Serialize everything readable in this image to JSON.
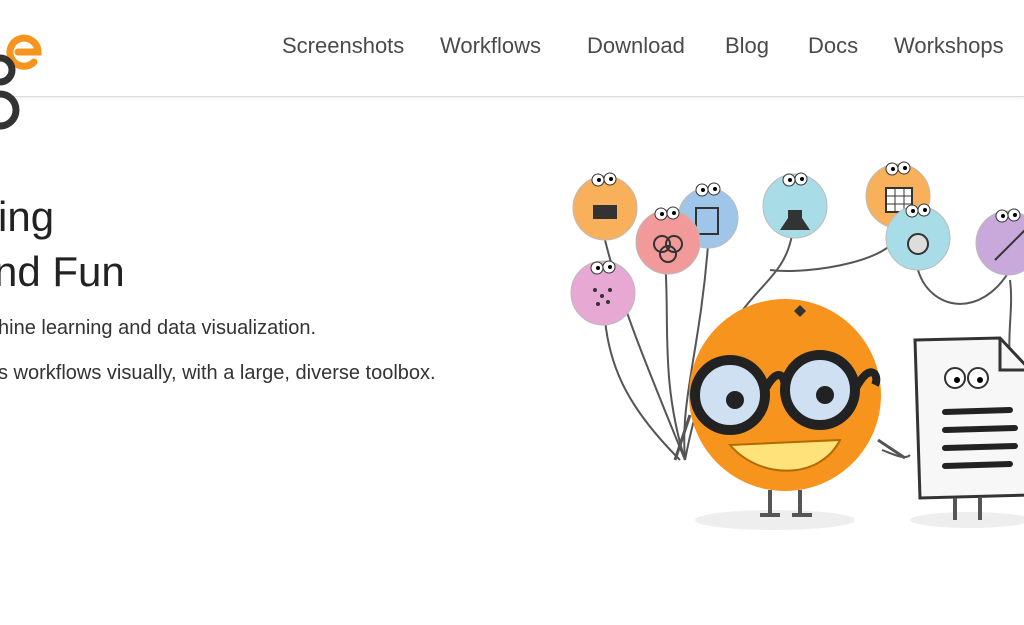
{
  "nav": {
    "items": [
      {
        "label": "Screenshots"
      },
      {
        "label": "Workflows"
      },
      {
        "label": "Download"
      },
      {
        "label": "Blog"
      },
      {
        "label": "Docs"
      },
      {
        "label": "Workshops"
      }
    ]
  },
  "hero": {
    "title_line1": "ing",
    "title_line2": "nd Fun",
    "line1": "hine learning and data visualization.",
    "line2": "s workflows visually, with a large, diverse toolbox."
  },
  "colors": {
    "brand_orange": "#f7941d",
    "logo_dark": "#333333",
    "mascot_orange": "#f7941d"
  }
}
